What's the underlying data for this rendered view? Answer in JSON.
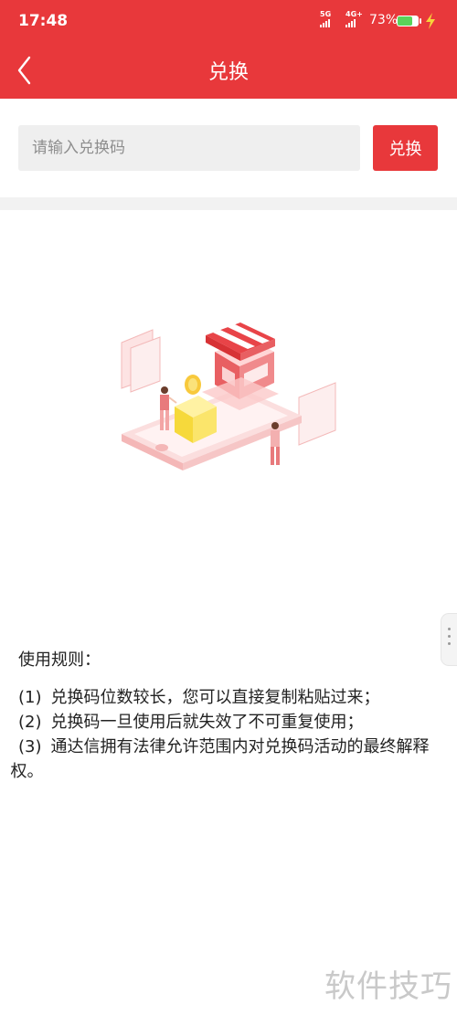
{
  "status_bar": {
    "time": "17:48",
    "signal_1_label": "5G",
    "signal_2_label": "4G+",
    "battery_percent": "73%",
    "battery_level": 0.73
  },
  "header": {
    "back_icon": "chevron-left-icon",
    "title": "兑换"
  },
  "redeem": {
    "placeholder": "请输入兑换码",
    "value": "",
    "button_label": "兑换"
  },
  "rules": {
    "title": "使用规则：",
    "items": [
      {
        "num": "(1)",
        "text": "兑换码位数较长，您可以直接复制粘贴过来；"
      },
      {
        "num": "(2)",
        "text": "兑换码一旦使用后就失效了不可重复使用；"
      },
      {
        "num": "(3)",
        "text": "通达信拥有法律允许范围内对兑换码活动的最终解释权。"
      }
    ]
  },
  "watermark": "软件技巧",
  "colors": {
    "accent": "#e8383b",
    "battery_fill": "#5ad35a",
    "background": "#ffffff"
  }
}
